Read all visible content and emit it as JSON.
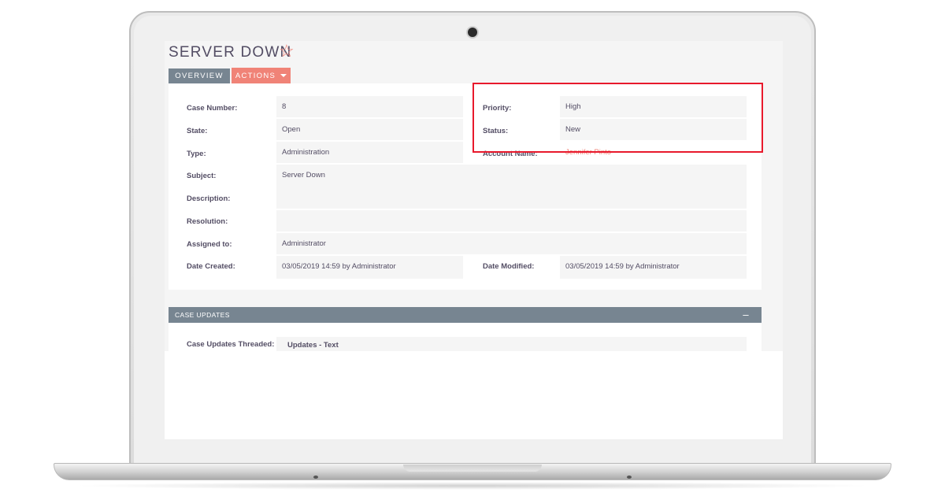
{
  "record": {
    "title": "SERVER DOWN",
    "favorite_icon": "star-outline-icon"
  },
  "tabs": {
    "overview": "OVERVIEW",
    "actions": "ACTIONS"
  },
  "fields": {
    "case_number": {
      "label": "Case Number:",
      "value": "8"
    },
    "priority": {
      "label": "Priority:",
      "value": "High"
    },
    "state": {
      "label": "State:",
      "value": "Open"
    },
    "status": {
      "label": "Status:",
      "value": "New"
    },
    "type": {
      "label": "Type:",
      "value": "Administration"
    },
    "account_name": {
      "label": "Account Name:",
      "value": "Jennifer Pinto"
    },
    "subject": {
      "label": "Subject:",
      "value": "Server Down"
    },
    "description": {
      "label": "Description:",
      "value": ""
    },
    "resolution": {
      "label": "Resolution:",
      "value": ""
    },
    "assigned_to": {
      "label": "Assigned to:",
      "value": "Administrator"
    },
    "date_created": {
      "label": "Date Created:",
      "value": "03/05/2019 14:59 by Administrator"
    },
    "date_modified": {
      "label": "Date Modified:",
      "value": "03/05/2019 14:59 by Administrator"
    }
  },
  "case_updates": {
    "header": "CASE UPDATES",
    "collapse_symbol": "–",
    "threaded_label": "Case Updates Threaded:",
    "threaded_value": "Updates - Text"
  },
  "colors": {
    "accent": "#f08377",
    "tab_gray": "#778591",
    "text": "#534d64",
    "highlight_box": "#e8192c"
  }
}
